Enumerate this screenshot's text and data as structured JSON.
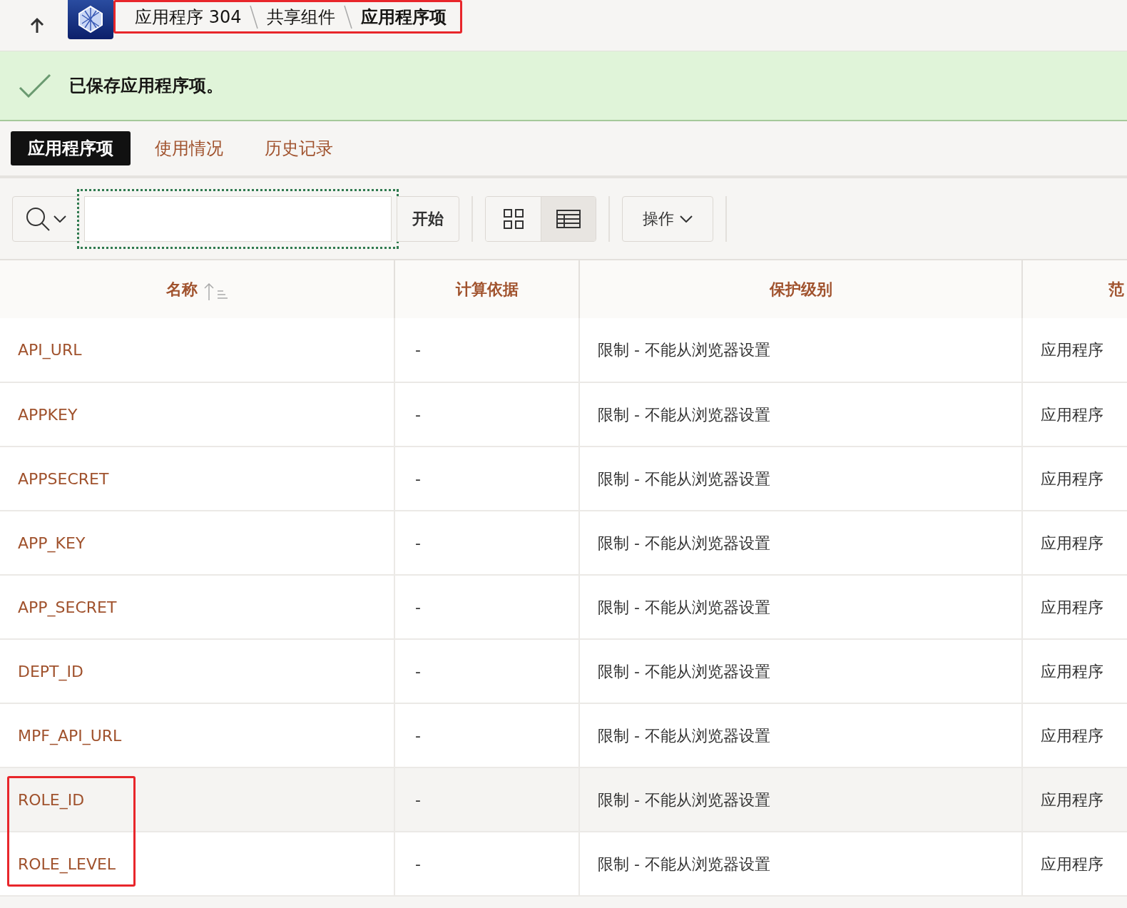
{
  "breadcrumb": [
    {
      "label": "应用程序 304",
      "current": false
    },
    {
      "label": "共享组件",
      "current": false
    },
    {
      "label": "应用程序项",
      "current": true
    }
  ],
  "message": "已保存应用程序项。",
  "tabs": [
    {
      "label": "应用程序项",
      "selected": true
    },
    {
      "label": "使用情况",
      "selected": false
    },
    {
      "label": "历史记录",
      "selected": false
    }
  ],
  "toolbar": {
    "go_button": "开始",
    "views": [
      {
        "kind": "icons",
        "selected": false
      },
      {
        "kind": "report",
        "selected": true
      }
    ],
    "actions_button": "操作"
  },
  "table": {
    "columns": [
      {
        "label": "名称",
        "sorted": true
      },
      {
        "label": "计算依据",
        "sorted": false
      },
      {
        "label": "保护级别",
        "sorted": false
      },
      {
        "label": "范",
        "sorted": false
      }
    ],
    "rows": [
      {
        "cells": [
          "API_URL",
          "-",
          "限制 - 不能从浏览器设置",
          "应用程序"
        ],
        "hovered": false
      },
      {
        "cells": [
          "APPKEY",
          "-",
          "限制 - 不能从浏览器设置",
          "应用程序"
        ],
        "hovered": false
      },
      {
        "cells": [
          "APPSECRET",
          "-",
          "限制 - 不能从浏览器设置",
          "应用程序"
        ],
        "hovered": false
      },
      {
        "cells": [
          "APP_KEY",
          "-",
          "限制 - 不能从浏览器设置",
          "应用程序"
        ],
        "hovered": false
      },
      {
        "cells": [
          "APP_SECRET",
          "-",
          "限制 - 不能从浏览器设置",
          "应用程序"
        ],
        "hovered": false
      },
      {
        "cells": [
          "DEPT_ID",
          "-",
          "限制 - 不能从浏览器设置",
          "应用程序"
        ],
        "hovered": false
      },
      {
        "cells": [
          "MPF_API_URL",
          "-",
          "限制 - 不能从浏览器设置",
          "应用程序"
        ],
        "hovered": false
      },
      {
        "cells": [
          "ROLE_ID",
          "-",
          "限制 - 不能从浏览器设置",
          "应用程序"
        ],
        "hovered": true
      },
      {
        "cells": [
          "ROLE_LEVEL",
          "-",
          "限制 - 不能从浏览器设置",
          "应用程序"
        ],
        "hovered": false
      }
    ]
  }
}
